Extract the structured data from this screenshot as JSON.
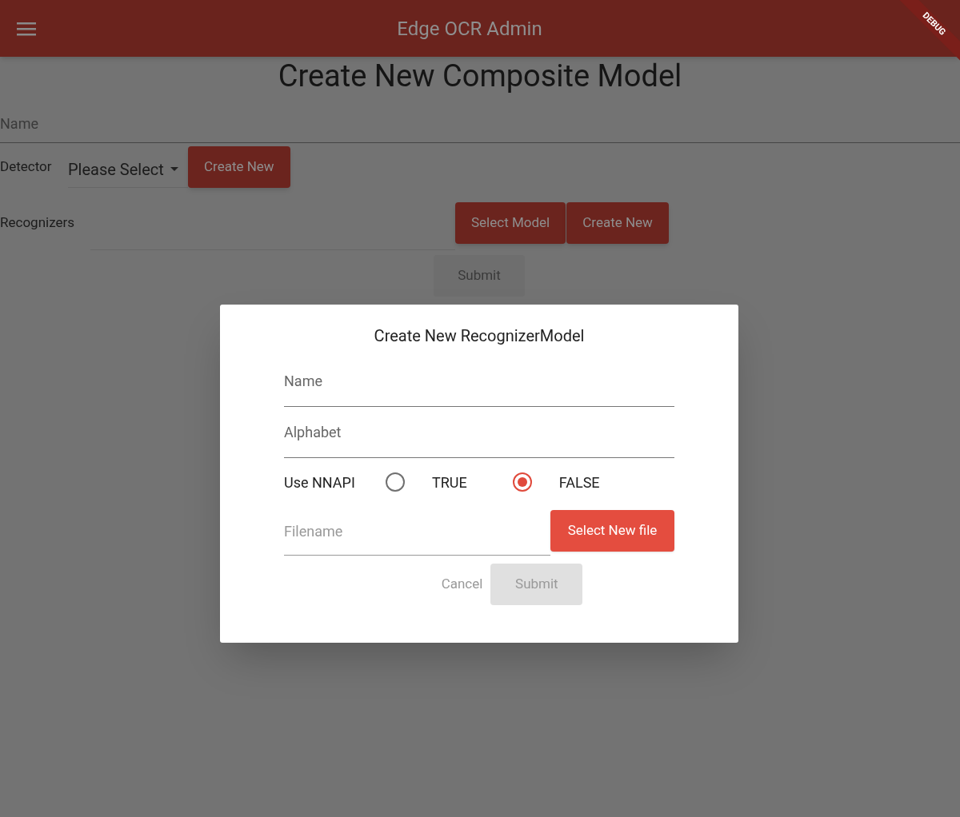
{
  "app_bar": {
    "title": "Edge OCR Admin"
  },
  "debug_banner": "DEBUG",
  "page": {
    "heading": "Create New Composite Model",
    "name_field": {
      "placeholder": "Name"
    },
    "detector": {
      "label": "Detector",
      "value": "Please Select",
      "button": "Create New"
    },
    "recognizers": {
      "label": "Recognizers",
      "buttons": [
        "Select Model",
        "Create New"
      ]
    },
    "submit": {
      "label": "Submit",
      "disabled": true
    }
  },
  "dialog": {
    "title": "Create New RecognizerModel",
    "name_field": {
      "placeholder": "Name"
    },
    "alphabet_field": {
      "placeholder": "Alphabet"
    },
    "nnapi": {
      "label": "Use NNAPI",
      "options": [
        {
          "label": "TRUE",
          "selected": false
        },
        {
          "label": "FALSE",
          "selected": true
        }
      ]
    },
    "filename_field": {
      "placeholder": "Filename"
    },
    "file_button": "Select New file",
    "cancel": "Cancel",
    "submit": {
      "label": "Submit",
      "disabled": true
    }
  }
}
